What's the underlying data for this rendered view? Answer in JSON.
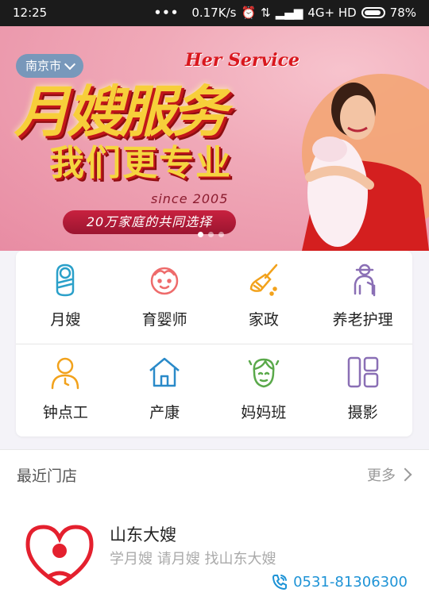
{
  "status_bar": {
    "time": "12:25",
    "network_speed": "0.17K/s",
    "network_type": "4G+ HD",
    "battery": "78%"
  },
  "banner": {
    "city": "南京市",
    "english_title": "Her Service",
    "title_line1": "月嫂服务",
    "title_line2": "我们更专业",
    "since": "since 2005",
    "slogan": "20万家庭的共同选择",
    "slides": 3,
    "active_slide": 1
  },
  "services": [
    {
      "label": "月嫂",
      "icon": "swaddled-baby-icon",
      "color": "#2aa0c9"
    },
    {
      "label": "育婴师",
      "icon": "baby-face-icon",
      "color": "#ee6b6b"
    },
    {
      "label": "家政",
      "icon": "broom-icon",
      "color": "#f2a21c"
    },
    {
      "label": "养老护理",
      "icon": "elderly-cane-icon",
      "color": "#8a6fb5"
    },
    {
      "label": "钟点工",
      "icon": "person-clock-icon",
      "color": "#f2a21c"
    },
    {
      "label": "产康",
      "icon": "home-icon",
      "color": "#2a8ac9"
    },
    {
      "label": "妈妈班",
      "icon": "mother-face-icon",
      "color": "#5aa94a"
    },
    {
      "label": "摄影",
      "icon": "camera-grid-icon",
      "color": "#8a6fb5"
    }
  ],
  "recent": {
    "title": "最近门店",
    "more": "更多"
  },
  "store": {
    "name": "山东大嫂",
    "description": "学月嫂 请月嫂 找山东大嫂",
    "phone": "0531-81306300",
    "logo_text": "山东大嫂"
  }
}
